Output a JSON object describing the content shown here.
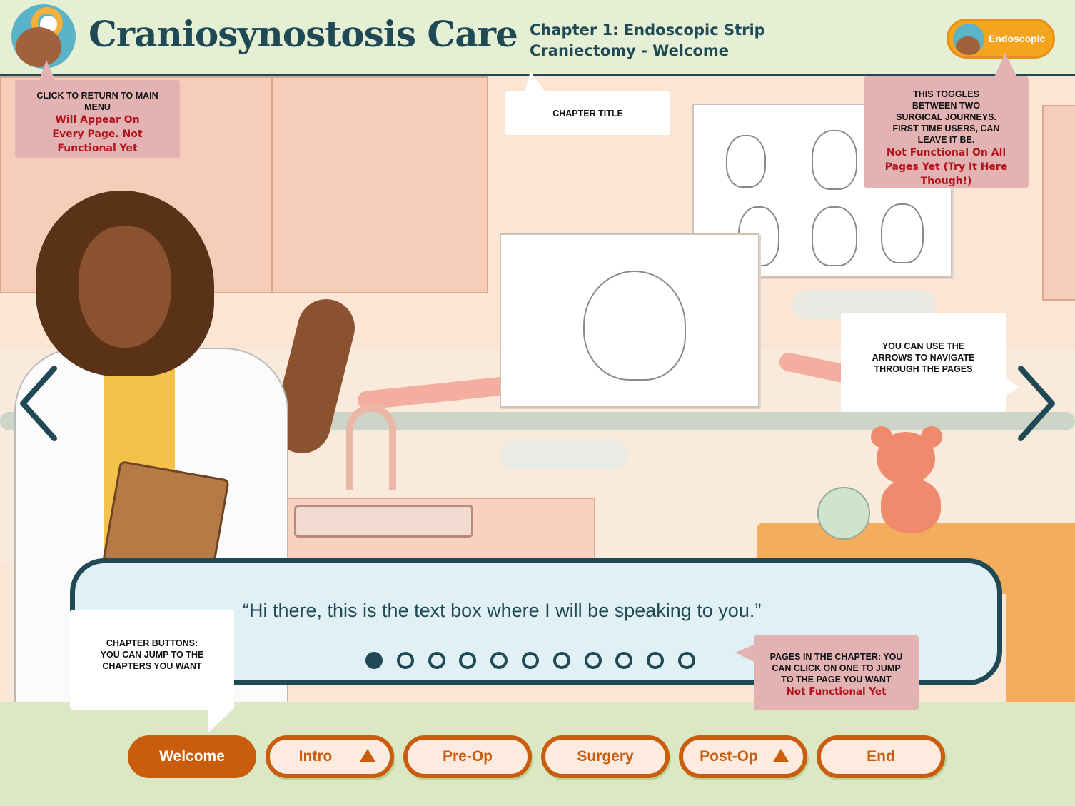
{
  "header": {
    "app_title": "Craniosynostosis Care",
    "chapter_line1": "Chapter 1: Endoscopic Strip",
    "chapter_line2": "Craniectomy - Welcome",
    "toggle_label": "Endoscopic"
  },
  "annotations": {
    "menu": {
      "caption": "CLICK TO RETURN TO MAIN MENU",
      "note": "Will Appear On Every Page. Not Functional Yet"
    },
    "chapter_title": {
      "caption": "CHAPTER TITLE"
    },
    "toggle": {
      "caption": "THIS TOGGLES BETWEEN TWO SURGICAL JOURNEYS. FIRST TIME USERS, CAN LEAVE IT BE.",
      "note": "Not Functional On All Pages Yet (Try It Here Though!)"
    },
    "arrows": {
      "caption": "YOU CAN USE THE ARROWS TO NAVIGATE THROUGH THE PAGES"
    },
    "chapter_buttons": {
      "caption": "CHAPTER BUTTONS: YOU CAN JUMP TO THE CHAPTERS YOU WANT"
    },
    "pages": {
      "caption": "PAGES IN THE CHAPTER: YOU CAN CLICK ON ONE TO JUMP TO THE PAGE YOU WANT",
      "note": "Not Functional Yet"
    }
  },
  "dialogue": {
    "text": "“Hi there, this is the text box where I will be speaking to you.”"
  },
  "pagination": {
    "total": 11,
    "current": 1
  },
  "chapters": [
    {
      "label": "Welcome",
      "active": true,
      "expandable": false
    },
    {
      "label": "Intro",
      "active": false,
      "expandable": true
    },
    {
      "label": "Pre-Op",
      "active": false,
      "expandable": false
    },
    {
      "label": "Surgery",
      "active": false,
      "expandable": false
    },
    {
      "label": "Post-Op",
      "active": false,
      "expandable": true
    },
    {
      "label": "End",
      "active": false,
      "expandable": false
    }
  ],
  "icons": {
    "prev": "chevron-left-icon",
    "next": "chevron-right-icon",
    "expand": "triangle-up-icon"
  },
  "colors": {
    "navy": "#1f4a55",
    "orange": "#c95d0d",
    "toggle": "#f5a41d",
    "note_pink": "#e3b3b4",
    "note_red": "#b3131b"
  }
}
